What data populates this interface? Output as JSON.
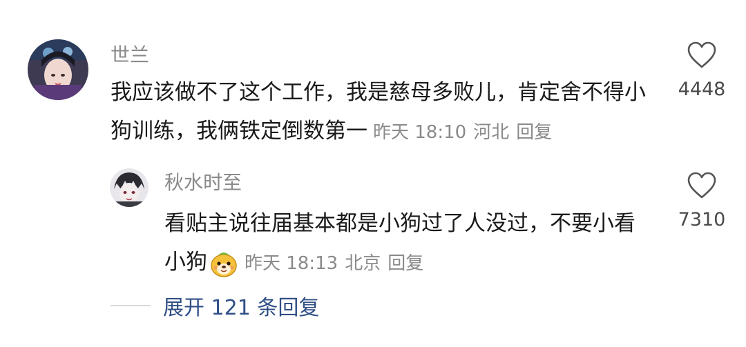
{
  "comments": [
    {
      "username": "世兰",
      "text": "我应该做不了这个工作，我是慈母多败儿，肯定舍不得小狗训练，我俩铁定倒数第一",
      "time": "昨天 18:10",
      "location": "河北",
      "reply_label": "回复",
      "likes": "4448"
    },
    {
      "username": "秋水时至",
      "text": "看贴主说往届基本都是小狗过了人没过，不要小看小狗",
      "time": "昨天 18:13",
      "location": "北京",
      "reply_label": "回复",
      "likes": "7310"
    }
  ],
  "expand": {
    "label": "展开 121 条回复"
  },
  "colors": {
    "username": "#8a8a8a",
    "text": "#1a1a1a",
    "link": "#2f4f86"
  },
  "icons": {
    "like": "heart-outline-icon",
    "emoji": "dog-face-emoji-icon"
  }
}
